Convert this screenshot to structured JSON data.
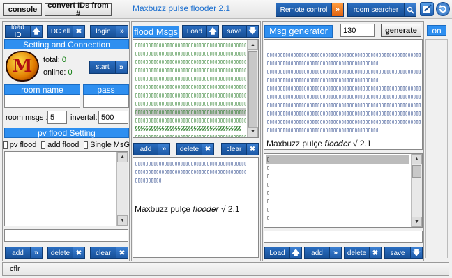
{
  "topbar": {
    "console": "console",
    "convert": "convert IDs from #",
    "title": "Maxbuzz pulse flooder 2.1",
    "remote": "Remote control",
    "remote_icon": "»",
    "room_searcher": "room searcher",
    "search_icon": "🔍"
  },
  "left": {
    "load_id": "load ID",
    "dc_all": "DC all",
    "login": "login",
    "setting_header": "Setting and Connection",
    "logo_letter": "M",
    "total_label": "total:",
    "total_value": "0",
    "online_label": "online:",
    "online_value": "0",
    "start": "start",
    "room_name_header": "room name",
    "pass_header": "pass",
    "room_msgs_label": "room msgs :",
    "room_msgs_value": "5",
    "invertal_label": "invertal:",
    "invertal_value": "500",
    "pv_header": "pv flood Setting",
    "pv_flood": "pv flood",
    "add_flood": "add flood",
    "single_msg": "Single MsG",
    "add": "add",
    "delete": "delete",
    "clear": "clear"
  },
  "middle": {
    "flood_msgs": "flood Msgs",
    "load": "Load",
    "save": "save",
    "lines": [
      "▯▯▯▯▯▯▯▯▯▯▯▯▯▯▯▯▯▯▯▯▯▯▯▯▯▯▯▯▯▯▯▯▯▯▯▯▯▯▯▯▯▯",
      "▯▯▯▯▯▯▯▯▯▯▯▯▯▯▯▯▯▯▯▯▯▯▯▯▯▯▯▯▯▯▯▯▯▯▯▯▯▯▯▯▯▯",
      "▯▯▯▯▯▯▯▯▯▯▯▯▯▯▯▯▯▯▯▯▯▯▯▯▯▯▯▯▯▯▯▯▯▯▯▯▯▯▯▯▯▯",
      "▯▯▯▯▯▯▯▯▯▯▯▯▯▯▯▯▯▯▯▯▯▯▯▯▯▯▯▯▯▯▯▯▯▯▯▯▯▯▯▯▯▯",
      "▯▯▯▯▯▯▯▯▯▯▯▯▯▯▯▯▯▯▯▯▯▯▯▯▯▯▯▯▯▯▯▯▯▯▯▯▯▯▯▯▯▯",
      "▯▯▯▯▯▯▯▯▯▯▯▯▯▯▯▯▯▯▯▯▯▯▯▯▯▯▯▯▯▯▯▯▯▯▯▯▯▯▯▯▯▯",
      "▯▯▯▯▯▯▯▯▯▯▯▯▯▯▯▯▯▯▯▯▯▯▯▯▯▯▯▯▯▯▯▯▯▯▯▯▯▯▯▯▯▯",
      "▯▯▯▯▯▯▯▯▯▯▯▯▯▯▯▯▯▯▯▯▯▯▯▯▯▯▯▯▯▯▯▯▯▯▯▯▯▯▯▯▯▯",
      "▯▯▯▯▯▯▯▯▯▯▯▯▯▯▯▯▯▯▯▯▯▯▯▯▯▯▯▯▯▯▯▯▯▯▯▯▯▯▯▯▯▯",
      "▯▯▯▯▯▯▯▯▯▯▯▯▯▯▯▯▯▯▯▯▯▯▯▯▯▯▯▯▯▯▯▯▯▯▯▯▯▯▯▯▯▯",
      "§§§§§§§§§§§§§§§§§§§§§§§§§§§§§§§§§§§§§§§§",
      "▯▯▯▯▯▯▯▯▯▯▯▯▯▯▯▯▯▯▯▯▯▯▯▯▯▯▯▯▯▯▯▯▯▯▯▯▯▯▯▯▯▯"
    ],
    "add": "add",
    "delete": "delete",
    "clear": "clear",
    "preview_lines": [
      "▯▯▯▯▯▯▯▯▯▯▯▯▯▯▯▯▯▯▯▯▯▯▯▯▯▯▯▯▯▯▯▯▯▯▯▯▯▯▯▯▯▯",
      "▯▯▯▯▯▯▯▯▯▯▯▯▯▯▯▯▯▯▯▯▯▯▯▯▯▯▯▯▯▯▯▯▯▯▯▯▯▯▯▯▯▯",
      "▯▯▯▯▯▯▯▯▯▯"
    ],
    "preview_sig": "Maxbuzz pulҫe 𝑓𝑙𝑜𝑜𝑑𝑒𝑟 √ 2.1"
  },
  "right": {
    "msg_generator": "Msg generator",
    "count": "130",
    "generate": "generate",
    "on": "on",
    "gen_lines": [
      "▯▯▯▯▯▯▯▯▯▯▯▯▯▯▯▯▯▯▯▯▯▯▯▯▯▯▯▯▯▯▯▯▯▯▯▯▯▯▯▯▯▯▯▯▯▯▯▯▯▯▯▯▯▯▯▯▯▯",
      "▯▯▯▯▯▯▯▯▯▯▯▯▯▯▯▯▯▯▯▯▯▯▯▯▯▯▯▯▯▯▯▯▯▯▯▯▯▯▯▯▯▯",
      "▯▯▯▯▯▯▯▯▯▯▯▯▯▯▯▯▯▯▯▯▯▯▯▯▯▯▯▯▯▯▯▯▯▯▯▯▯▯▯▯▯▯▯▯▯▯▯▯▯▯▯▯▯▯▯▯▯▯",
      "▯▯▯▯▯▯▯▯▯▯▯▯▯▯▯▯▯▯▯▯▯▯▯▯▯▯▯▯▯▯▯▯▯▯▯▯▯▯▯▯▯▯",
      "▯▯▯▯▯▯▯▯▯▯▯▯▯▯▯▯▯▯▯▯▯▯▯▯▯▯▯▯▯▯▯▯▯▯▯▯▯▯▯▯▯▯▯▯▯▯▯▯▯▯▯▯▯▯▯▯▯▯",
      "▯▯▯▯▯▯▯▯▯▯▯▯▯▯▯▯▯▯▯▯▯▯▯▯▯▯▯▯▯▯▯▯▯▯▯▯▯▯▯▯▯▯▯▯▯▯▯▯▯▯▯▯▯▯▯▯▯▯",
      "▯▯▯▯▯▯▯▯▯▯▯▯▯▯▯▯▯▯▯▯▯▯▯▯▯▯▯▯▯▯▯▯▯▯▯▯▯▯▯▯▯▯▯▯▯▯▯▯▯▯▯▯▯▯▯▯▯▯",
      "▯▯▯▯▯▯▯▯▯▯▯▯▯▯▯▯▯▯▯▯▯▯▯▯▯▯▯▯▯▯▯▯▯▯▯▯▯▯▯▯▯▯▯▯▯▯▯▯▯▯▯▯▯▯▯▯▯▯",
      "▯▯▯▯▯▯▯▯▯▯▯▯▯▯▯▯▯▯▯▯▯▯▯▯▯▯▯▯▯▯▯▯▯▯▯▯▯▯▯▯▯▯▯▯▯▯▯▯▯▯▯▯▯▯▯▯▯▯",
      "▯▯▯▯▯▯▯▯▯▯▯▯▯▯▯▯▯▯▯▯▯▯▯▯▯▯▯▯▯▯▯▯▯▯▯▯▯▯▯▯▯▯"
    ],
    "gen_sig": "Maxbuzz pulҫe 𝑓𝑙𝑜𝑜𝑑𝑒𝑟 √ 2.1",
    "list_items": [
      "▯",
      "▯",
      "▯",
      "▯",
      "▯",
      "▯",
      "▯",
      "▯"
    ],
    "load": "Load",
    "add": "add",
    "delete": "delete",
    "save": "save"
  },
  "status": {
    "text": "cflr"
  },
  "colors": {
    "accent": "#2e8ff0",
    "button_blue": "#174f96",
    "title_blue": "#1c6fcf",
    "orange": "#e0620f"
  }
}
